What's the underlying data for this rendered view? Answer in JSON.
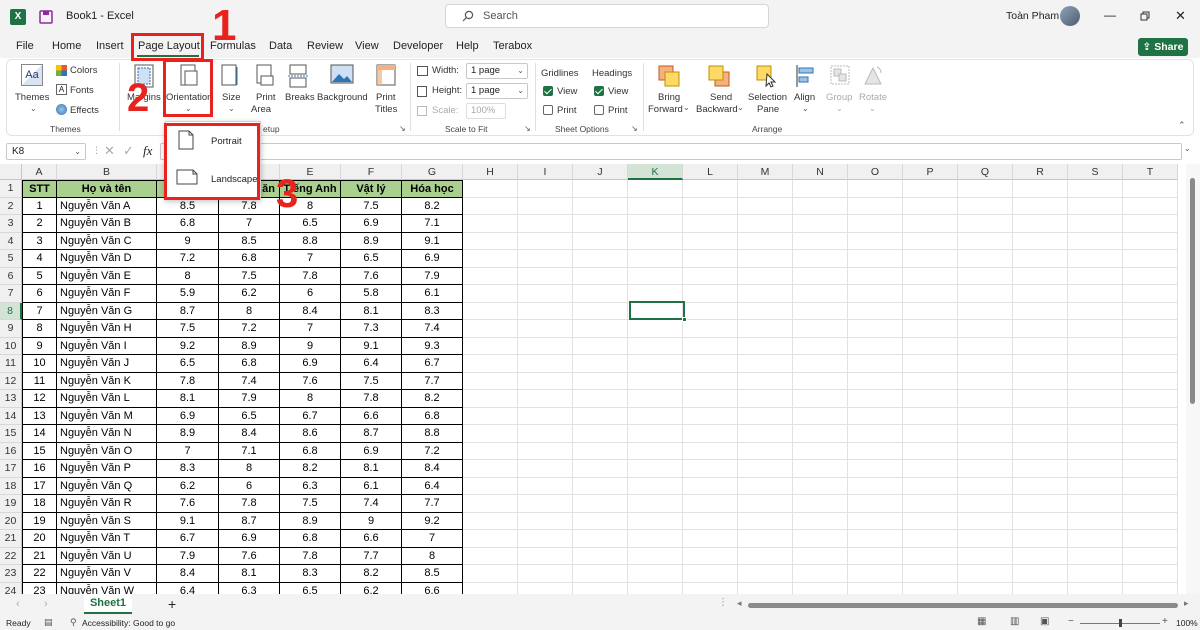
{
  "title": "Book1  -  Excel",
  "search_placeholder": "Search",
  "user_name": "Toàn Pham",
  "share_label": "Share",
  "menu": [
    "File",
    "Home",
    "Insert",
    "Page Layout",
    "Formulas",
    "Data",
    "Review",
    "View",
    "Developer",
    "Help",
    "Terabox"
  ],
  "ribbon": {
    "themes": {
      "themes": "Themes",
      "colors": "Colors",
      "fonts": "Fonts",
      "effects": "Effects",
      "group_label": "Themes"
    },
    "page_setup": {
      "margins": "Margins",
      "orientation": "Orientation",
      "size": "Size",
      "print_area": [
        "Print",
        "Area"
      ],
      "breaks": "Breaks",
      "background": "Background",
      "print_titles": [
        "Print",
        "Titles"
      ],
      "group_label": "etup"
    },
    "scale_to_fit": {
      "width_label": "Width:",
      "width_value": "1 page",
      "height_label": "Height:",
      "height_value": "1 page",
      "scale_label": "Scale:",
      "scale_value": "100%",
      "group_label": "Scale to Fit"
    },
    "sheet_options": {
      "gridlines": "Gridlines",
      "headings": "Headings",
      "view": "View",
      "print": "Print",
      "group_label": "Sheet Options"
    },
    "arrange": {
      "bring_forward": [
        "Bring",
        "Forward"
      ],
      "send_backward": [
        "Send",
        "Backward"
      ],
      "selection_pane": [
        "Selection",
        "Pane"
      ],
      "align": "Align",
      "group": "Group",
      "rotate": "Rotate",
      "group_label": "Arrange"
    }
  },
  "orientation_menu": {
    "portrait": "Portrait",
    "landscape": "Landscape"
  },
  "annotations": [
    "1",
    "2",
    "3"
  ],
  "name_box": "K8",
  "fx": "fx",
  "columns": [
    "A",
    "B",
    "C",
    "D",
    "E",
    "F",
    "G",
    "H",
    "I",
    "J",
    "K",
    "L",
    "M",
    "N",
    "O",
    "P",
    "Q",
    "R",
    "S",
    "T"
  ],
  "table": {
    "headers": [
      "STT",
      "Họ và tên",
      "",
      "ăn",
      "Tiếng Anh",
      "Vật lý",
      "Hóa học"
    ],
    "rows": [
      [
        "1",
        "Nguyễn Văn A",
        "8.5",
        "7.8",
        "8",
        "7.5",
        "8.2"
      ],
      [
        "2",
        "Nguyễn Văn B",
        "6.8",
        "7",
        "6.5",
        "6.9",
        "7.1"
      ],
      [
        "3",
        "Nguyễn Văn C",
        "9",
        "8.5",
        "8.8",
        "8.9",
        "9.1"
      ],
      [
        "4",
        "Nguyễn Văn D",
        "7.2",
        "6.8",
        "7",
        "6.5",
        "6.9"
      ],
      [
        "5",
        "Nguyễn Văn E",
        "8",
        "7.5",
        "7.8",
        "7.6",
        "7.9"
      ],
      [
        "6",
        "Nguyễn Văn F",
        "5.9",
        "6.2",
        "6",
        "5.8",
        "6.1"
      ],
      [
        "7",
        "Nguyễn Văn G",
        "8.7",
        "8",
        "8.4",
        "8.1",
        "8.3"
      ],
      [
        "8",
        "Nguyễn Văn H",
        "7.5",
        "7.2",
        "7",
        "7.3",
        "7.4"
      ],
      [
        "9",
        "Nguyễn Văn I",
        "9.2",
        "8.9",
        "9",
        "9.1",
        "9.3"
      ],
      [
        "10",
        "Nguyễn Văn J",
        "6.5",
        "6.8",
        "6.9",
        "6.4",
        "6.7"
      ],
      [
        "11",
        "Nguyễn Văn K",
        "7.8",
        "7.4",
        "7.6",
        "7.5",
        "7.7"
      ],
      [
        "12",
        "Nguyễn Văn L",
        "8.1",
        "7.9",
        "8",
        "7.8",
        "8.2"
      ],
      [
        "13",
        "Nguyễn Văn M",
        "6.9",
        "6.5",
        "6.7",
        "6.6",
        "6.8"
      ],
      [
        "14",
        "Nguyễn Văn N",
        "8.9",
        "8.4",
        "8.6",
        "8.7",
        "8.8"
      ],
      [
        "15",
        "Nguyễn Văn O",
        "7",
        "7.1",
        "6.8",
        "6.9",
        "7.2"
      ],
      [
        "16",
        "Nguyễn Văn P",
        "8.3",
        "8",
        "8.2",
        "8.1",
        "8.4"
      ],
      [
        "17",
        "Nguyễn Văn Q",
        "6.2",
        "6",
        "6.3",
        "6.1",
        "6.4"
      ],
      [
        "18",
        "Nguyễn Văn R",
        "7.6",
        "7.8",
        "7.5",
        "7.4",
        "7.7"
      ],
      [
        "19",
        "Nguyễn Văn S",
        "9.1",
        "8.7",
        "8.9",
        "9",
        "9.2"
      ],
      [
        "20",
        "Nguyễn Văn T",
        "6.7",
        "6.9",
        "6.8",
        "6.6",
        "7"
      ],
      [
        "21",
        "Nguyễn Văn U",
        "7.9",
        "7.6",
        "7.8",
        "7.7",
        "8"
      ],
      [
        "22",
        "Nguyễn Văn V",
        "8.4",
        "8.1",
        "8.3",
        "8.2",
        "8.5"
      ],
      [
        "23",
        "Nguyễn Văn W",
        "6.4",
        "6.3",
        "6.5",
        "6.2",
        "6.6"
      ]
    ]
  },
  "row_numbers": [
    "1",
    "2",
    "3",
    "4",
    "5",
    "6",
    "7",
    "8",
    "9",
    "10",
    "11",
    "12",
    "13",
    "14",
    "15",
    "16",
    "17",
    "18",
    "19",
    "20",
    "21",
    "22",
    "23",
    "24"
  ],
  "sheet_tab": "Sheet1",
  "add_sheet": "+",
  "status": {
    "ready": "Ready",
    "accessibility": "Accessibility: Good to go",
    "zoom": "100%"
  },
  "colors": {
    "header_fill": "#a9d08e",
    "excel_green": "#1f7244",
    "annotation_red": "#e8231d"
  }
}
